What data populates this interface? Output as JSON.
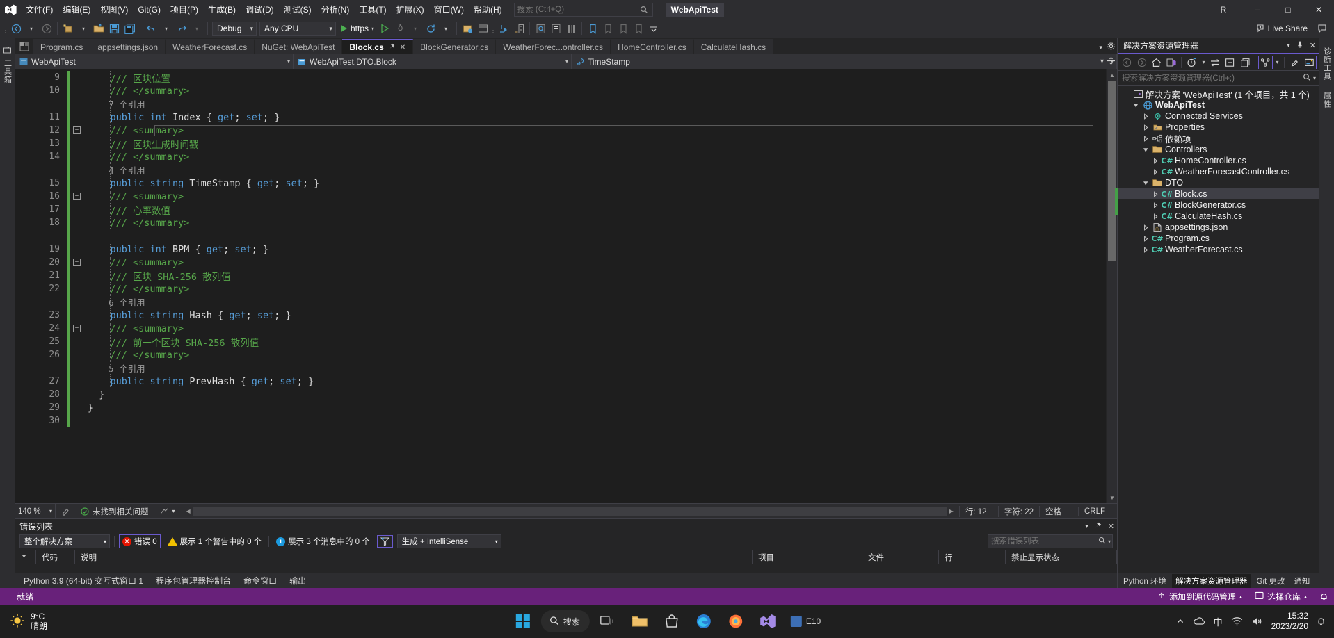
{
  "app": {
    "window_title": "WebApiTest",
    "solution_badge": "WebApiTest"
  },
  "menu": {
    "items": [
      {
        "label": "文件(F)"
      },
      {
        "label": "编辑(E)"
      },
      {
        "label": "视图(V)"
      },
      {
        "label": "Git(G)"
      },
      {
        "label": "项目(P)"
      },
      {
        "label": "生成(B)"
      },
      {
        "label": "调试(D)"
      },
      {
        "label": "测试(S)"
      },
      {
        "label": "分析(N)"
      },
      {
        "label": "工具(T)"
      },
      {
        "label": "扩展(X)"
      },
      {
        "label": "窗口(W)"
      },
      {
        "label": "帮助(H)"
      }
    ],
    "search_placeholder": "搜索 (Ctrl+Q)"
  },
  "titlebar": {
    "account_initial": "R",
    "minimize": "─",
    "maximize": "□",
    "close": "✕"
  },
  "toolbar": {
    "config": "Debug",
    "platform": "Any CPU",
    "run_label": "https",
    "live_share": "Live Share"
  },
  "doctabs": {
    "tabs": [
      {
        "label": "Program.cs",
        "active": false
      },
      {
        "label": "appsettings.json",
        "active": false
      },
      {
        "label": "WeatherForecast.cs",
        "active": false
      },
      {
        "label": "NuGet: WebApiTest",
        "active": false
      },
      {
        "label": "Block.cs",
        "active": true
      },
      {
        "label": "BlockGenerator.cs",
        "active": false
      },
      {
        "label": "WeatherForec...ontroller.cs",
        "active": false
      },
      {
        "label": "HomeController.cs",
        "active": false
      },
      {
        "label": "CalculateHash.cs",
        "active": false
      }
    ]
  },
  "navbar": {
    "project": "WebApiTest",
    "type": "WebApiTest.DTO.Block",
    "member": "TimeStamp"
  },
  "editor": {
    "lines": [
      {
        "num": "9",
        "fold": "",
        "indent": 2,
        "current": false,
        "tokens": [
          {
            "t": "    /// ",
            "c": "cmt"
          },
          {
            "t": "区块位置",
            "c": "cmt"
          }
        ]
      },
      {
        "num": "10",
        "fold": "",
        "indent": 2,
        "current": false,
        "tokens": [
          {
            "t": "    /// </summary>",
            "c": "cmt"
          }
        ]
      },
      {
        "num": "",
        "fold": "",
        "indent": 2,
        "current": false,
        "tokens": [
          {
            "t": "    7 个引用",
            "c": "codelens"
          }
        ]
      },
      {
        "num": "11",
        "fold": "",
        "indent": 2,
        "current": false,
        "tokens": [
          {
            "t": "    ",
            "c": "plain"
          },
          {
            "t": "public",
            "c": "kw"
          },
          {
            "t": " ",
            "c": "plain"
          },
          {
            "t": "int",
            "c": "kw"
          },
          {
            "t": " Index { ",
            "c": "idn"
          },
          {
            "t": "get",
            "c": "kw"
          },
          {
            "t": "; ",
            "c": "idn"
          },
          {
            "t": "set",
            "c": "kw"
          },
          {
            "t": "; }",
            "c": "idn"
          }
        ]
      },
      {
        "num": "12",
        "fold": "minus",
        "indent": 2,
        "current": true,
        "tokens": [
          {
            "t": "    /// <summary>",
            "c": "cmt"
          }
        ]
      },
      {
        "num": "13",
        "fold": "",
        "indent": 2,
        "current": false,
        "tokens": [
          {
            "t": "    /// ",
            "c": "cmt"
          },
          {
            "t": "区块生成时间戳",
            "c": "cmt"
          }
        ]
      },
      {
        "num": "14",
        "fold": "",
        "indent": 2,
        "current": false,
        "tokens": [
          {
            "t": "    /// </summary>",
            "c": "cmt"
          }
        ]
      },
      {
        "num": "",
        "fold": "",
        "indent": 2,
        "current": false,
        "tokens": [
          {
            "t": "    4 个引用",
            "c": "codelens"
          }
        ]
      },
      {
        "num": "15",
        "fold": "",
        "indent": 2,
        "current": false,
        "tokens": [
          {
            "t": "    ",
            "c": "plain"
          },
          {
            "t": "public",
            "c": "kw"
          },
          {
            "t": " ",
            "c": "plain"
          },
          {
            "t": "string",
            "c": "kw"
          },
          {
            "t": " TimeStamp { ",
            "c": "idn"
          },
          {
            "t": "get",
            "c": "kw"
          },
          {
            "t": "; ",
            "c": "idn"
          },
          {
            "t": "set",
            "c": "kw"
          },
          {
            "t": "; }",
            "c": "idn"
          }
        ]
      },
      {
        "num": "16",
        "fold": "minus",
        "indent": 2,
        "current": false,
        "tokens": [
          {
            "t": "    /// <summary>",
            "c": "cmt"
          }
        ]
      },
      {
        "num": "17",
        "fold": "",
        "indent": 2,
        "current": false,
        "tokens": [
          {
            "t": "    /// ",
            "c": "cmt"
          },
          {
            "t": "心率数值",
            "c": "cmt"
          }
        ]
      },
      {
        "num": "18",
        "fold": "",
        "indent": 2,
        "current": false,
        "tokens": [
          {
            "t": "    /// </summary>",
            "c": "cmt"
          }
        ]
      },
      {
        "num": "",
        "fold": "",
        "indent": 2,
        "current": false,
        "tokens": [
          {
            "t": "",
            "c": "plain"
          }
        ]
      },
      {
        "num": "19",
        "fold": "",
        "indent": 2,
        "current": false,
        "tokens": [
          {
            "t": "    ",
            "c": "plain"
          },
          {
            "t": "public",
            "c": "kw"
          },
          {
            "t": " ",
            "c": "plain"
          },
          {
            "t": "int",
            "c": "kw"
          },
          {
            "t": " BPM { ",
            "c": "idn"
          },
          {
            "t": "get",
            "c": "kw"
          },
          {
            "t": "; ",
            "c": "idn"
          },
          {
            "t": "set",
            "c": "kw"
          },
          {
            "t": "; }",
            "c": "idn"
          }
        ]
      },
      {
        "num": "20",
        "fold": "minus",
        "indent": 2,
        "current": false,
        "tokens": [
          {
            "t": "    /// <summary>",
            "c": "cmt"
          }
        ]
      },
      {
        "num": "21",
        "fold": "",
        "indent": 2,
        "current": false,
        "tokens": [
          {
            "t": "    /// ",
            "c": "cmt"
          },
          {
            "t": "区块 SHA-256 散列值",
            "c": "cmt"
          }
        ]
      },
      {
        "num": "22",
        "fold": "",
        "indent": 2,
        "current": false,
        "tokens": [
          {
            "t": "    /// </summary>",
            "c": "cmt"
          }
        ]
      },
      {
        "num": "",
        "fold": "",
        "indent": 2,
        "current": false,
        "tokens": [
          {
            "t": "    6 个引用",
            "c": "codelens"
          }
        ]
      },
      {
        "num": "23",
        "fold": "",
        "indent": 2,
        "current": false,
        "tokens": [
          {
            "t": "    ",
            "c": "plain"
          },
          {
            "t": "public",
            "c": "kw"
          },
          {
            "t": " ",
            "c": "plain"
          },
          {
            "t": "string",
            "c": "kw"
          },
          {
            "t": " Hash { ",
            "c": "idn"
          },
          {
            "t": "get",
            "c": "kw"
          },
          {
            "t": "; ",
            "c": "idn"
          },
          {
            "t": "set",
            "c": "kw"
          },
          {
            "t": "; }",
            "c": "idn"
          }
        ]
      },
      {
        "num": "24",
        "fold": "minus",
        "indent": 2,
        "current": false,
        "tokens": [
          {
            "t": "    /// <summary>",
            "c": "cmt"
          }
        ]
      },
      {
        "num": "25",
        "fold": "",
        "indent": 2,
        "current": false,
        "tokens": [
          {
            "t": "    /// ",
            "c": "cmt"
          },
          {
            "t": "前一个区块 SHA-256 散列值",
            "c": "cmt"
          }
        ]
      },
      {
        "num": "26",
        "fold": "",
        "indent": 2,
        "current": false,
        "tokens": [
          {
            "t": "    /// </summary>",
            "c": "cmt"
          }
        ]
      },
      {
        "num": "",
        "fold": "",
        "indent": 2,
        "current": false,
        "tokens": [
          {
            "t": "    5 个引用",
            "c": "codelens"
          }
        ]
      },
      {
        "num": "27",
        "fold": "",
        "indent": 2,
        "current": false,
        "tokens": [
          {
            "t": "    ",
            "c": "plain"
          },
          {
            "t": "public",
            "c": "kw"
          },
          {
            "t": " ",
            "c": "plain"
          },
          {
            "t": "string",
            "c": "kw"
          },
          {
            "t": " PrevHash { ",
            "c": "idn"
          },
          {
            "t": "get",
            "c": "kw"
          },
          {
            "t": "; ",
            "c": "idn"
          },
          {
            "t": "set",
            "c": "kw"
          },
          {
            "t": "; }",
            "c": "idn"
          }
        ]
      },
      {
        "num": "28",
        "fold": "",
        "indent": 1,
        "current": false,
        "tokens": [
          {
            "t": "  }",
            "c": "idn"
          }
        ]
      },
      {
        "num": "29",
        "fold": "",
        "indent": 0,
        "current": false,
        "tokens": [
          {
            "t": "}",
            "c": "idn"
          }
        ]
      },
      {
        "num": "30",
        "fold": "",
        "indent": 0,
        "current": false,
        "tokens": [
          {
            "t": "",
            "c": "plain"
          }
        ]
      }
    ]
  },
  "editor_status": {
    "zoom": "140 %",
    "issues": "未找到相关问题",
    "line": "行: 12",
    "col": "字符: 22",
    "spaces": "空格",
    "eol": "CRLF"
  },
  "errorlist": {
    "title": "错误列表",
    "scope": "整个解决方案",
    "errors": "错误 0",
    "warnings": "展示 1 个警告中的 0 个",
    "messages": "展示 3 个消息中的 0 个",
    "source": "生成 + IntelliSense",
    "search_placeholder": "搜索错误列表",
    "columns": [
      "代码",
      "说明",
      "项目",
      "文件",
      "行",
      "禁止显示状态"
    ]
  },
  "tool_tabs": {
    "items": [
      {
        "label": "Python 3.9 (64-bit) 交互式窗口 1",
        "active": false
      },
      {
        "label": "程序包管理器控制台",
        "active": false
      },
      {
        "label": "命令窗口",
        "active": false
      },
      {
        "label": "输出",
        "active": false
      }
    ]
  },
  "solution_explorer": {
    "title": "解决方案资源管理器",
    "search_placeholder": "搜索解决方案资源管理器(Ctrl+;)",
    "tree": [
      {
        "label": "解决方案 'WebApiTest' (1 个项目，共 1 个)",
        "indent": 0,
        "twisty": "",
        "icon": "solution",
        "bold": false,
        "selected": false
      },
      {
        "label": "WebApiTest",
        "indent": 1,
        "twisty": "open",
        "icon": "project",
        "bold": true,
        "selected": false
      },
      {
        "label": "Connected Services",
        "indent": 2,
        "twisty": "closed",
        "icon": "services",
        "bold": false,
        "selected": false
      },
      {
        "label": "Properties",
        "indent": 2,
        "twisty": "closed",
        "icon": "props",
        "bold": false,
        "selected": false
      },
      {
        "label": "依赖项",
        "indent": 2,
        "twisty": "closed",
        "icon": "deps",
        "bold": false,
        "selected": false
      },
      {
        "label": "Controllers",
        "indent": 2,
        "twisty": "open",
        "icon": "folder",
        "bold": false,
        "selected": false
      },
      {
        "label": "HomeController.cs",
        "indent": 3,
        "twisty": "closed",
        "icon": "cs",
        "bold": false,
        "selected": false
      },
      {
        "label": "WeatherForecastController.cs",
        "indent": 3,
        "twisty": "closed",
        "icon": "cs",
        "bold": false,
        "selected": false
      },
      {
        "label": "DTO",
        "indent": 2,
        "twisty": "open",
        "icon": "folder",
        "bold": false,
        "selected": false
      },
      {
        "label": "Block.cs",
        "indent": 3,
        "twisty": "closed",
        "icon": "cs",
        "bold": false,
        "selected": true
      },
      {
        "label": "BlockGenerator.cs",
        "indent": 3,
        "twisty": "closed",
        "icon": "cs",
        "bold": false,
        "selected": false
      },
      {
        "label": "CalculateHash.cs",
        "indent": 3,
        "twisty": "closed",
        "icon": "cs",
        "bold": false,
        "selected": false
      },
      {
        "label": "appsettings.json",
        "indent": 2,
        "twisty": "closed",
        "icon": "json",
        "bold": false,
        "selected": false
      },
      {
        "label": "Program.cs",
        "indent": 2,
        "twisty": "closed",
        "icon": "cs",
        "bold": false,
        "selected": false
      },
      {
        "label": "WeatherForecast.cs",
        "indent": 2,
        "twisty": "closed",
        "icon": "cs",
        "bold": false,
        "selected": false
      }
    ],
    "bottom_tabs": [
      {
        "label": "Python 环境",
        "active": false
      },
      {
        "label": "解决方案资源管理器",
        "active": true
      },
      {
        "label": "Git 更改",
        "active": false
      },
      {
        "label": "通知",
        "active": false
      }
    ]
  },
  "left_strip": {
    "tabs": [
      {
        "label": "工具箱"
      }
    ]
  },
  "right_strip": {
    "tabs": [
      {
        "label": "诊断工具"
      },
      {
        "label": "属性"
      }
    ]
  },
  "statusbar": {
    "ready": "就绪",
    "add_to_source": "添加到源代码管理",
    "repo": "选择仓库"
  },
  "taskbar": {
    "weather_temp": "9°C",
    "weather_desc": "晴朗",
    "search_placeholder": "搜索",
    "e10_label": "E10",
    "time": "15:32",
    "date": "2023/2/20",
    "ime": "中"
  }
}
